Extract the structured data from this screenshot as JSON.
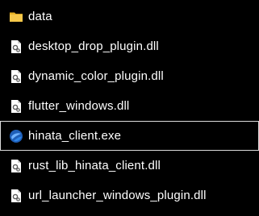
{
  "files": [
    {
      "name": "data",
      "icon": "folder-icon",
      "kind": "folder"
    },
    {
      "name": "desktop_drop_plugin.dll",
      "icon": "dll-file-icon",
      "kind": "dll"
    },
    {
      "name": "dynamic_color_plugin.dll",
      "icon": "dll-file-icon",
      "kind": "dll"
    },
    {
      "name": "flutter_windows.dll",
      "icon": "dll-file-icon",
      "kind": "dll"
    },
    {
      "name": "hinata_client.exe",
      "icon": "app-globe-icon",
      "kind": "exe",
      "selected": true
    },
    {
      "name": "rust_lib_hinata_client.dll",
      "icon": "dll-file-icon",
      "kind": "dll"
    },
    {
      "name": "url_launcher_windows_plugin.dll",
      "icon": "dll-file-icon",
      "kind": "dll"
    }
  ],
  "colors": {
    "background": "#000000",
    "text": "#ffffff",
    "selection_border": "#dcdcdc",
    "folder": "#f4c430",
    "app_icon": "#2a6fc9"
  }
}
